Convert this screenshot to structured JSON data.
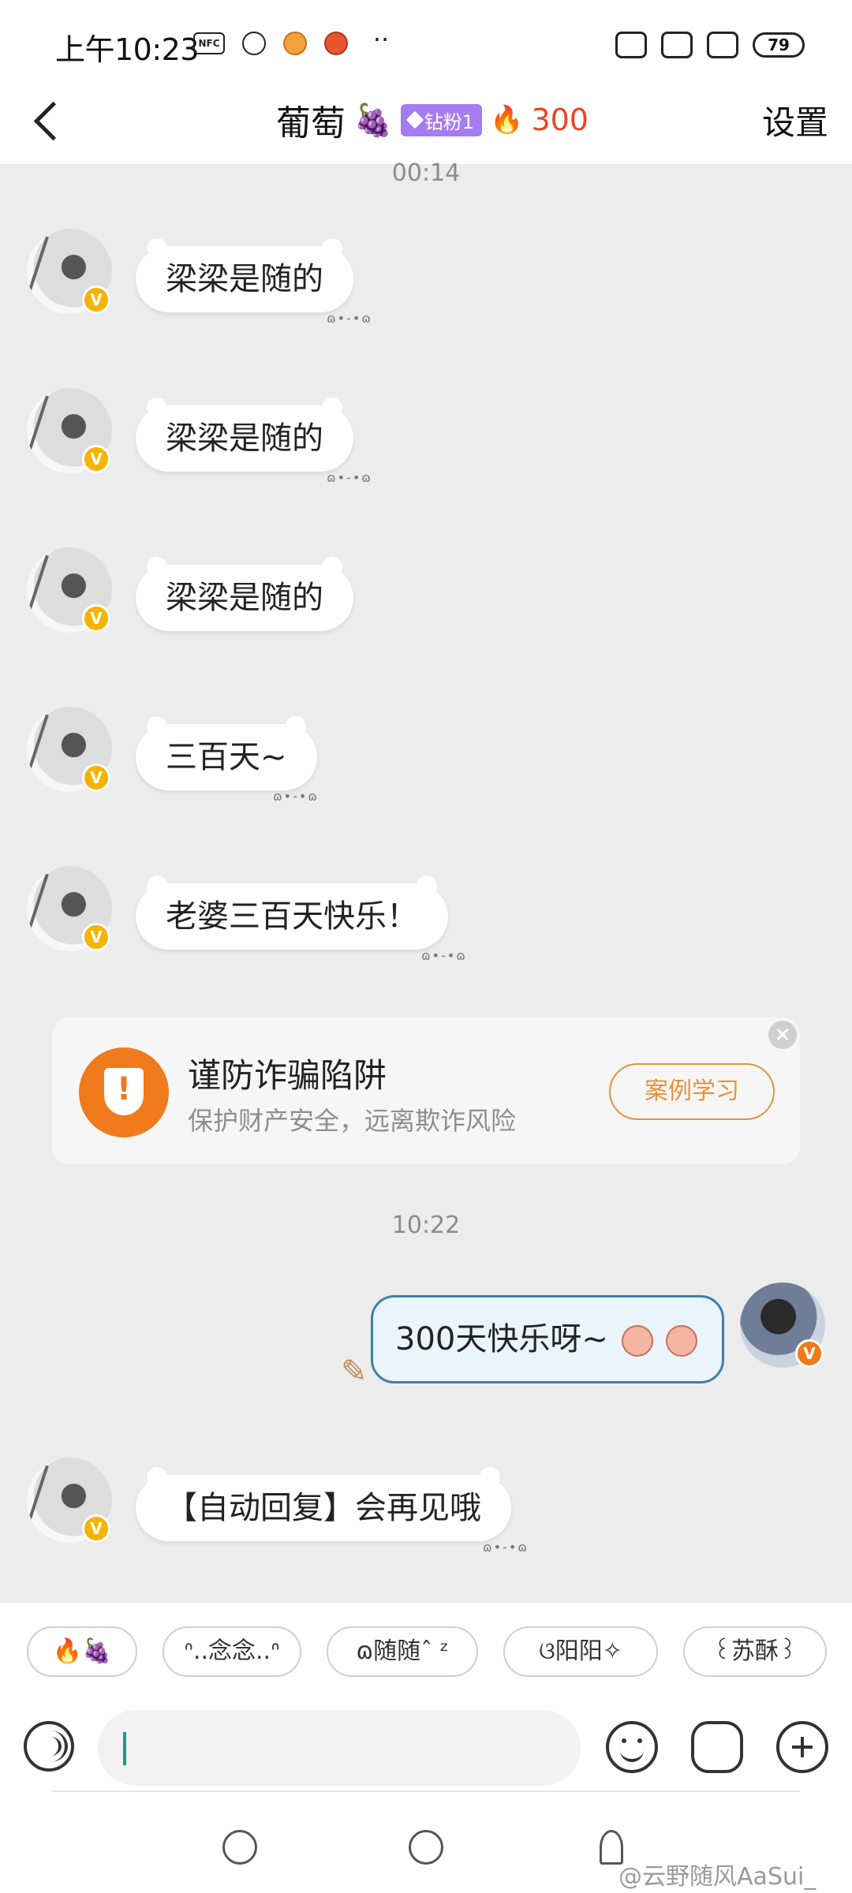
{
  "status_bar": {
    "time": "上午10:23",
    "nfc_label": "NFC",
    "more_dots": "··",
    "battery": "79"
  },
  "header": {
    "contact_name": "葡萄",
    "name_emoji": "🍇",
    "fan_badge": "钻粉1",
    "fire_emoji": "🔥",
    "fire_count": "300",
    "settings_label": "设置"
  },
  "chat": {
    "timestamp_top": "00:14",
    "incoming": [
      {
        "text": "梁梁是随的",
        "deco": "ɷ•-•ɷ"
      },
      {
        "text": "梁梁是随的",
        "deco": "ɷ•-•ɷ"
      },
      {
        "text": "梁梁是随的",
        "deco": ""
      },
      {
        "text": "三百天~",
        "deco": "ɷ•-•ɷ"
      },
      {
        "text": "老婆三百天快乐！",
        "deco": "ɷ•-•ɷ"
      }
    ],
    "safety_card": {
      "title": "谨防诈骗陷阱",
      "subtitle": "保护财产安全，远离欺诈风险",
      "button": "案例学习"
    },
    "timestamp_2": "10:22",
    "outgoing": {
      "text": "300天快乐呀~"
    },
    "auto_reply": {
      "text": "【自动回复】会再见哦",
      "deco": "ɷ•-•ɷ"
    }
  },
  "quick_replies": [
    "🔥🍇",
    "ᐢ..念念..ᐢ",
    "ɷ随随ˆ ᶻ",
    "ଓ阳阳✧",
    "꒰苏酥꒱"
  ],
  "watermark": "@云野随风AaSui_",
  "colors": {
    "accent_orange": "#f07a1c",
    "fire_red": "#ee4422",
    "badge_purple": "#a57cf2",
    "verified_gold": "#f4b400",
    "outgoing_border": "#3f7fa6"
  }
}
